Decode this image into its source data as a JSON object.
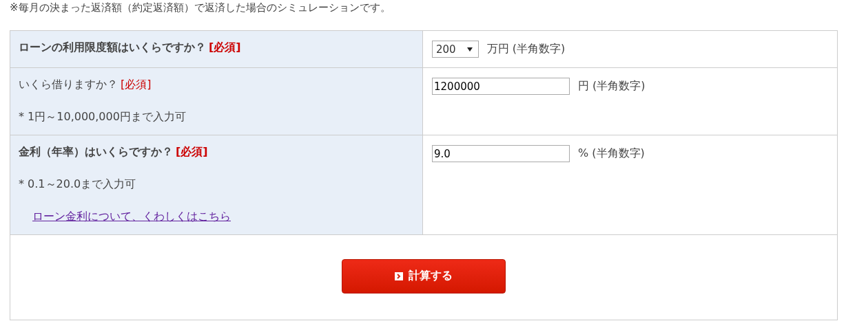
{
  "intro": "※毎月の決まった返済額（約定返済額）で返済した場合のシミュレーションです。",
  "rows": [
    {
      "question": "ローンの利用限度額はいくらですか？",
      "bold": true,
      "required": "[必須]",
      "notes": [],
      "input": {
        "kind": "select",
        "value": "200"
      },
      "unit": "万円 (半角数字)"
    },
    {
      "question": "いくら借りますか？",
      "bold": false,
      "required": "[必須]",
      "notes": [
        "* 1円～10,000,000円まで入力可"
      ],
      "input": {
        "kind": "text",
        "value": "1200000"
      },
      "unit": "円 (半角数字)"
    },
    {
      "question": "金利（年率）はいくらですか？",
      "bold": true,
      "required": "[必須]",
      "notes": [
        "* 0.1～20.0まで入力可"
      ],
      "link": "ローン金利について、くわしくはこちら",
      "input": {
        "kind": "text",
        "value": "9.0"
      },
      "unit": "% (半角数字)"
    }
  ],
  "button": "計算する"
}
